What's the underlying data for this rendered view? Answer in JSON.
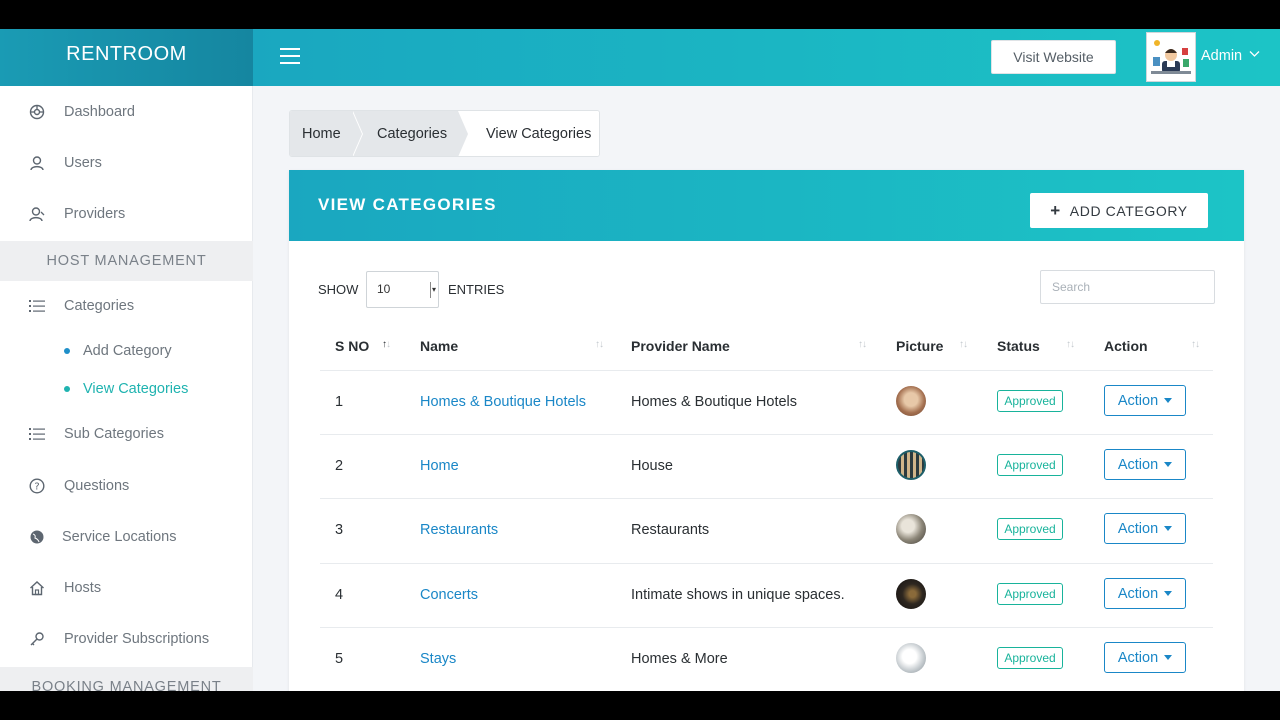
{
  "brand": "RENTROOM",
  "colors": {
    "accent": "#1cc4c6",
    "link": "#1a87c7",
    "approved": "#18b39b"
  },
  "sidebar": {
    "items": [
      {
        "label": "Dashboard",
        "icon": "dashboard-icon"
      },
      {
        "label": "Users",
        "icon": "user-icon"
      },
      {
        "label": "Providers",
        "icon": "providers-icon"
      }
    ],
    "section_host": "HOST MANAGEMENT",
    "categories_label": "Categories",
    "sub_items": [
      {
        "label": "Add Category",
        "active": false
      },
      {
        "label": "View Categories",
        "active": true
      }
    ],
    "items2": [
      {
        "label": "Sub Categories",
        "icon": "list-icon"
      },
      {
        "label": "Questions",
        "icon": "question-icon"
      },
      {
        "label": "Service Locations",
        "icon": "globe-icon"
      },
      {
        "label": "Hosts",
        "icon": "home-icon"
      },
      {
        "label": "Provider Subscriptions",
        "icon": "key-icon"
      }
    ],
    "section_booking": "BOOKING MANAGEMENT"
  },
  "topbar": {
    "visit_label": "Visit Website",
    "user_name": "Admin"
  },
  "breadcrumb": [
    "Home",
    "Categories",
    "View Categories"
  ],
  "card": {
    "title": "VIEW CATEGORIES",
    "add_label": "ADD CATEGORY",
    "show_label": "SHOW",
    "entries_value": "10",
    "entries_label": "ENTRIES",
    "search_placeholder": "Search"
  },
  "table": {
    "headers": [
      "S NO",
      "Name",
      "Provider Name",
      "Picture",
      "Status",
      "Action"
    ],
    "rows": [
      {
        "sno": "1",
        "name": "Homes & Boutique Hotels",
        "provider": "Homes & Boutique Hotels",
        "status": "Approved",
        "action": "Action"
      },
      {
        "sno": "2",
        "name": "Home",
        "provider": "House",
        "status": "Approved",
        "action": "Action"
      },
      {
        "sno": "3",
        "name": "Restaurants",
        "provider": "Restaurants",
        "status": "Approved",
        "action": "Action"
      },
      {
        "sno": "4",
        "name": "Concerts",
        "provider": "Intimate shows in unique spaces.",
        "status": "Approved",
        "action": "Action"
      },
      {
        "sno": "5",
        "name": "Stays",
        "provider": "Homes & More",
        "status": "Approved",
        "action": "Action"
      }
    ]
  }
}
